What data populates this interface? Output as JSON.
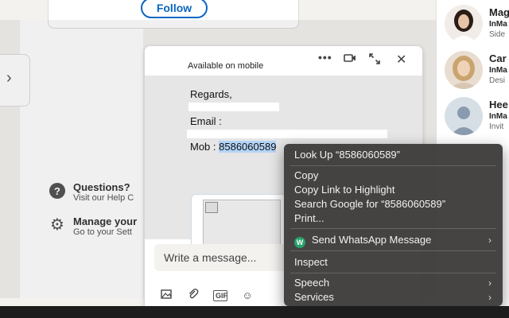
{
  "top_card": {
    "follow_label": "Follow"
  },
  "left_panel": {
    "help_title": "Questions?",
    "help_sub": "Visit our Help C",
    "manage_title": "Manage your",
    "manage_sub": "Go to your Sett"
  },
  "people": [
    {
      "name": "Mag",
      "line2": "InMa",
      "line3": "Side"
    },
    {
      "name": "Car",
      "line2": "InMa",
      "line3": "Desi"
    },
    {
      "name": "Hee",
      "line2": "InMa",
      "line3": "Invit"
    }
  ],
  "chat": {
    "status": "Available on mobile",
    "messages": {
      "regards": "Regards,",
      "email": "Email :",
      "mob_label": "Mob : ",
      "mob_number": "8586060589"
    },
    "composer_placeholder": "Write a message...",
    "gif_label": "GIF"
  },
  "context_menu": {
    "look_up": "Look Up “8586060589”",
    "copy": "Copy",
    "copy_link": "Copy Link to Highlight",
    "search_google": "Search Google for “8586060589”",
    "print": "Print...",
    "whatsapp": "Send WhatsApp Message",
    "whatsapp_icon_letter": "W",
    "inspect": "Inspect",
    "speech": "Speech",
    "services": "Services"
  },
  "colors": {
    "brand_blue": "#0a66c2",
    "selection": "#b4d4f7",
    "whatsapp_green": "#25a36a"
  }
}
